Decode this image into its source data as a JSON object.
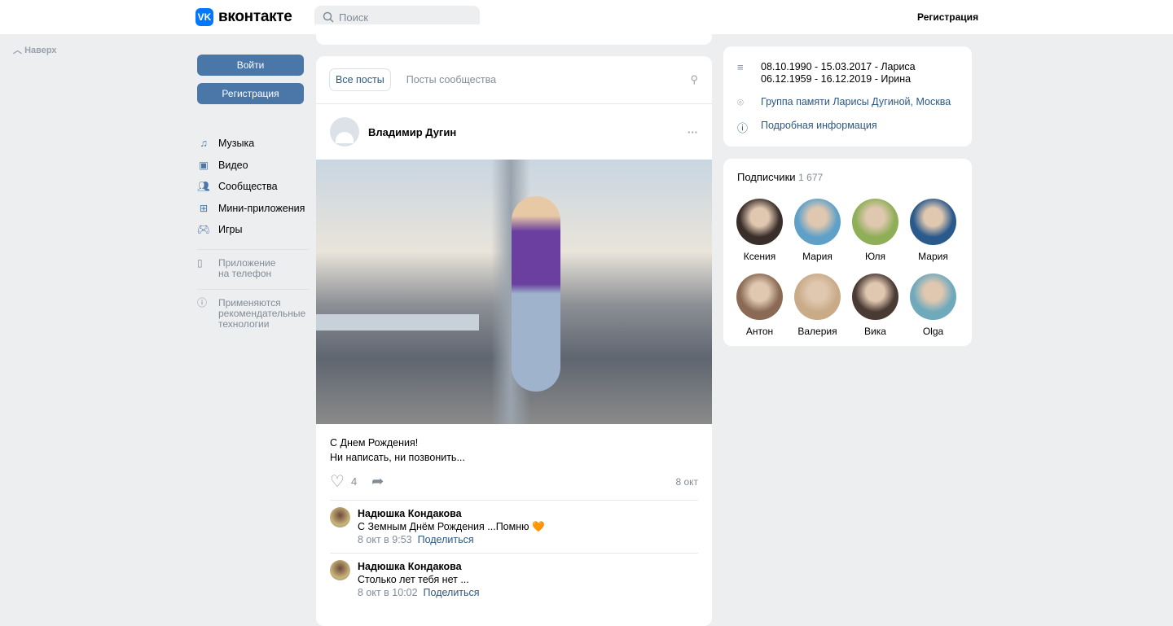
{
  "header": {
    "logo_text": "вконтакте",
    "search_placeholder": "Поиск",
    "register": "Регистрация"
  },
  "up": "Наверх",
  "left": {
    "login": "Войти",
    "register": "Регистрация",
    "nav": [
      {
        "label": "Музыка",
        "icon": "music-icon"
      },
      {
        "label": "Видео",
        "icon": "video-icon"
      },
      {
        "label": "Сообщества",
        "icon": "communities-icon"
      },
      {
        "label": "Мини-приложения",
        "icon": "apps-icon"
      },
      {
        "label": "Игры",
        "icon": "gamepad-icon"
      }
    ],
    "app": "Приложение на телефон",
    "recommend": "Применяются рекомендательные технологии"
  },
  "feed": {
    "tabs": [
      "Все посты",
      "Посты сообщества"
    ],
    "post": {
      "author": "Владимир Дугин",
      "text1": "С Днем Рождения!",
      "text2": "Ни написать, ни позвонить...",
      "likes": "4",
      "date": "8 окт",
      "comments": [
        {
          "author": "Надюшка Кондакова",
          "text": "С Земным Днём Рождения ...Помню",
          "emoji": "🧡",
          "time": "8 окт в 9:53",
          "share": "Поделиться"
        },
        {
          "author": "Надюшка Кондакова",
          "text": "Столько лет тебя нет ...",
          "time": "8 окт в 10:02",
          "share": "Поделиться"
        }
      ]
    }
  },
  "info": {
    "line1": "08.10.1990 - 15.03.2017 - Лариса",
    "line2": "06.12.1959 - 16.12.2019 - Ирина",
    "location": "Группа памяти Ларисы Дугиной, Москва",
    "details": "Подробная информация"
  },
  "subscribers": {
    "title": "Подписчики",
    "count": "1 677",
    "people": [
      {
        "name": "Ксения",
        "color": "#3a2e2a"
      },
      {
        "name": "Мария",
        "color": "#5fa0c8"
      },
      {
        "name": "Юля",
        "color": "#8fae58"
      },
      {
        "name": "Мария",
        "color": "#2a5a8c"
      },
      {
        "name": "Антон",
        "color": "#8a6a55"
      },
      {
        "name": "Валерия",
        "color": "#c9ab88"
      },
      {
        "name": "Вика",
        "color": "#4a3a34"
      },
      {
        "name": "Olga",
        "color": "#6fa9bc"
      }
    ]
  }
}
